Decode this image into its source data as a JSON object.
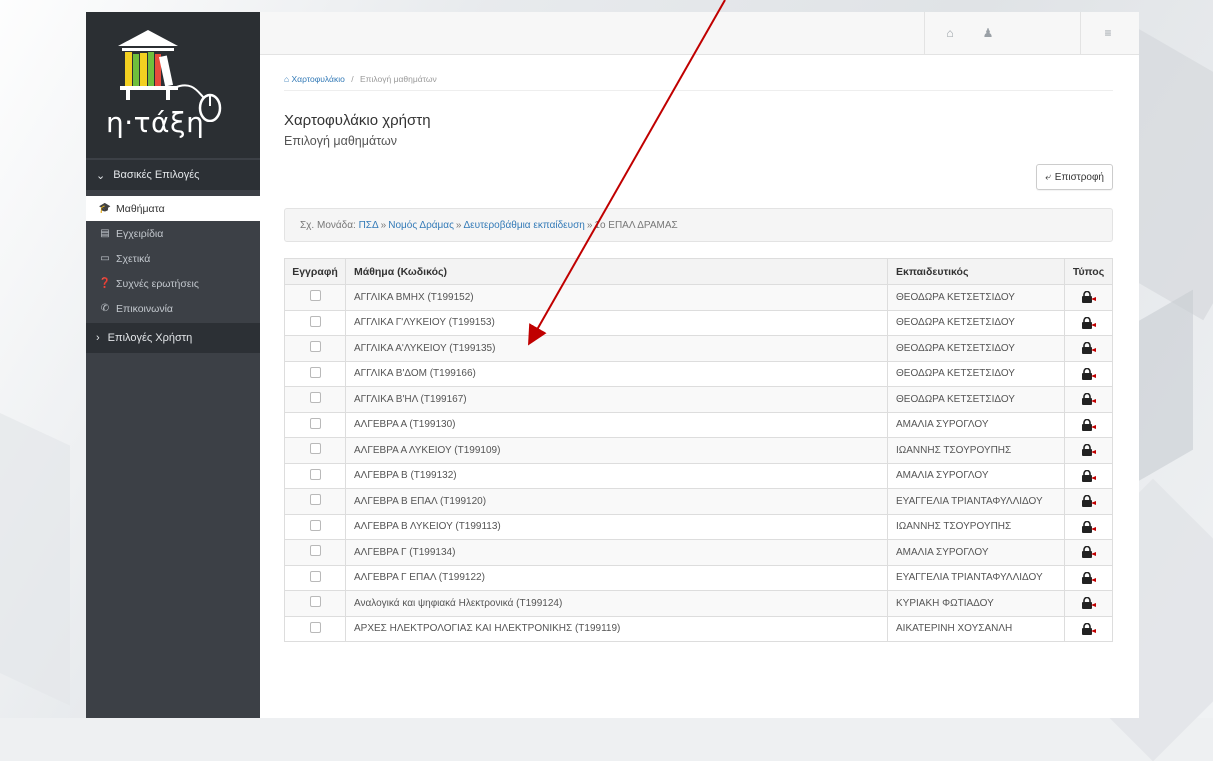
{
  "colors": {
    "accent": "#337ab7",
    "sidebar": "#3c4046",
    "sidebar_dark": "#2c3035",
    "arrow": "#c00000"
  },
  "logo": {
    "text": "η·τάξη"
  },
  "sidebar": {
    "section_basic": "Βασικές Επιλογές",
    "items": [
      {
        "label": "Μαθήματα",
        "icon": "graduation-cap-icon"
      },
      {
        "label": "Εγχειρίδια",
        "icon": "file-icon"
      },
      {
        "label": "Σχετικά",
        "icon": "credit-card-icon"
      },
      {
        "label": "Συχνές ερωτήσεις",
        "icon": "question-circle-icon"
      },
      {
        "label": "Επικοινωνία",
        "icon": "phone-icon"
      }
    ],
    "section_user": "Επιλογές Χρήστη"
  },
  "topbar": {
    "icons": [
      "home-icon",
      "user-icon",
      "sliders-icon"
    ]
  },
  "breadcrumb": {
    "home": "Χαρτοφυλάκιο",
    "current": "Επιλογή μαθημάτων",
    "sep": "/"
  },
  "page": {
    "title": "Χαρτοφυλάκιο χρήστη",
    "subtitle": "Επιλογή μαθημάτων",
    "back_label": "Επιστροφή"
  },
  "unit": {
    "prefix": "Σχ. Μονάδα:",
    "link1": "ΠΣΔ",
    "link2": "Νομός Δράμας",
    "link3": "Δευτεροβάθμια εκπαίδευση",
    "school": "1ο ΕΠΑΛ ΔΡΑΜΑΣ"
  },
  "table": {
    "headers": {
      "enroll": "Εγγραφή",
      "course": "Μάθημα (Κωδικός)",
      "teacher": "Εκπαιδευτικός",
      "type": "Τύπος"
    },
    "rows": [
      {
        "course": "ΑΓΓΛΙΚΑ ΒΜΗΧ (T199152)",
        "teacher": "ΘΕΟΔΩΡΑ ΚΕΤΣΕΤΣΙΔΟΥ"
      },
      {
        "course": "ΑΓΓΛΙΚΑ Γ'ΛΥΚΕΙΟΥ (T199153)",
        "teacher": "ΘΕΟΔΩΡΑ ΚΕΤΣΕΤΣΙΔΟΥ"
      },
      {
        "course": "ΑΓΓΛΙΚΑ Α'ΛΥΚΕΙΟΥ (T199135)",
        "teacher": "ΘΕΟΔΩΡΑ ΚΕΤΣΕΤΣΙΔΟΥ"
      },
      {
        "course": "ΑΓΓΛΙΚΑ Β'ΔΟΜ (T199166)",
        "teacher": "ΘΕΟΔΩΡΑ ΚΕΤΣΕΤΣΙΔΟΥ"
      },
      {
        "course": "ΑΓΓΛΙΚΑ Β'ΗΛ (T199167)",
        "teacher": "ΘΕΟΔΩΡΑ ΚΕΤΣΕΤΣΙΔΟΥ"
      },
      {
        "course": "ΑΛΓΕΒΡΑ Α (T199130)",
        "teacher": "ΑΜΑΛΙΑ ΣΥΡΟΓΛΟΥ"
      },
      {
        "course": "ΑΛΓΕΒΡΑ Α ΛΥΚΕΙΟΥ (T199109)",
        "teacher": "ΙΩΑΝΝΗΣ ΤΣΟΥΡΟΥΠΗΣ"
      },
      {
        "course": "ΑΛΓΕΒΡΑ Β (T199132)",
        "teacher": "ΑΜΑΛΙΑ ΣΥΡΟΓΛΟΥ"
      },
      {
        "course": "ΑΛΓΕΒΡΑ Β ΕΠΑΛ (T199120)",
        "teacher": "ΕΥΑΓΓΕΛΙΑ ΤΡΙΑΝΤΑΦΥΛΛΙΔΟΥ"
      },
      {
        "course": "ΑΛΓΕΒΡΑ Β ΛΥΚΕΙΟΥ (T199113)",
        "teacher": "ΙΩΑΝΝΗΣ ΤΣΟΥΡΟΥΠΗΣ"
      },
      {
        "course": "ΑΛΓΕΒΡΑ Γ (T199134)",
        "teacher": "ΑΜΑΛΙΑ ΣΥΡΟΓΛΟΥ"
      },
      {
        "course": "ΑΛΓΕΒΡΑ Γ ΕΠΑΛ (T199122)",
        "teacher": "ΕΥΑΓΓΕΛΙΑ ΤΡΙΑΝΤΑΦΥΛΛΙΔΟΥ"
      },
      {
        "course": "Αναλογικά και ψηφιακά Ηλεκτρονικά (T199124)",
        "teacher": "ΚΥΡΙΑΚΗ ΦΩΤΙΑΔΟΥ"
      },
      {
        "course": "ΑΡΧΕΣ ΗΛΕΚΤΡΟΛΟΓΙΑΣ ΚΑΙ ΗΛΕΚΤΡΟΝΙΚΗΣ (T199119)",
        "teacher": "ΑΙΚΑΤΕΡΙΝΗ ΧΟΥΣΑΝΛΗ"
      }
    ]
  }
}
